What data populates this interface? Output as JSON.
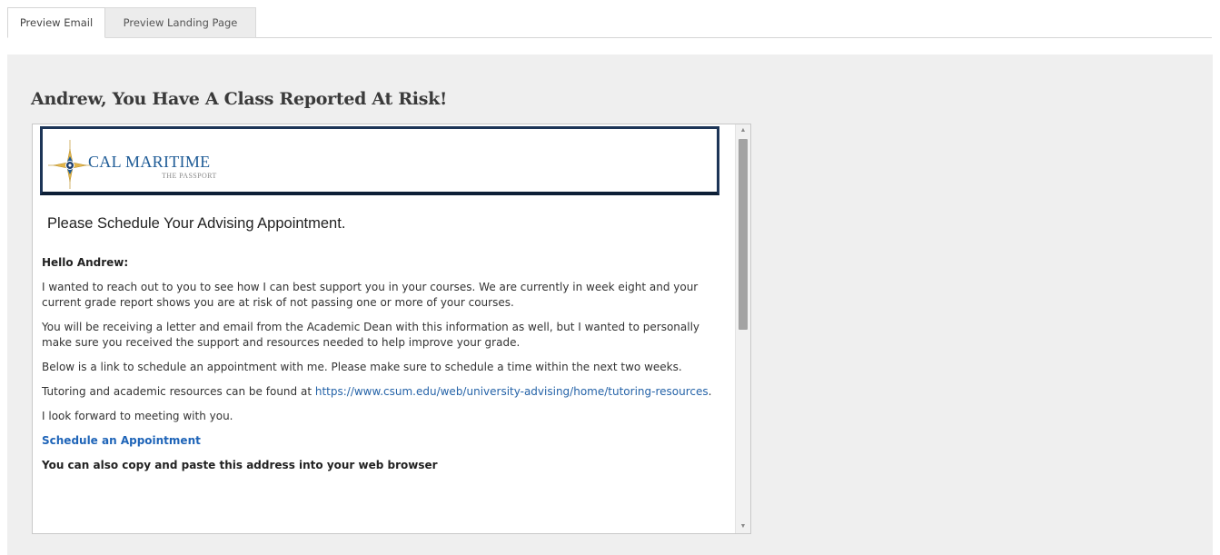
{
  "tabs": [
    {
      "label": "Preview Email"
    },
    {
      "label": "Preview Landing Page"
    }
  ],
  "email": {
    "subject": "Andrew, You Have A Class Reported At Risk!",
    "logo": {
      "name": "CAL MARITIME",
      "tagline": "THE PASSPORT",
      "icon": "compass-star-icon"
    },
    "lead": "Please Schedule Your Advising Appointment.",
    "greeting": "Hello Andrew:",
    "paragraph1": "I wanted to reach out to you to see how I can best support you in your courses. We are currently in week eight and your current grade report shows you are at risk of not passing one or more of your courses.",
    "paragraph2": "You will be receiving a letter and email from the Academic Dean with this information as well, but I wanted to personally make sure you received the support and resources needed to help improve your grade.",
    "paragraph3": "Below is a link to schedule an appointment with me. Please make sure to schedule a time within the next two weeks.",
    "paragraph4_prefix": "Tutoring and academic resources can be found at ",
    "paragraph4_link": "https://www.csum.edu/web/university-advising/home/tutoring-resources",
    "paragraph4_suffix": ".",
    "paragraph5": "I look forward to meeting with you.",
    "cta_link": "Schedule an Appointment",
    "copy_paste_text": "You can also copy and paste this address into your web browser"
  },
  "colors": {
    "accent_link": "#2563a8",
    "logo_border": "#1d3557",
    "panel_bg": "#efefef"
  }
}
